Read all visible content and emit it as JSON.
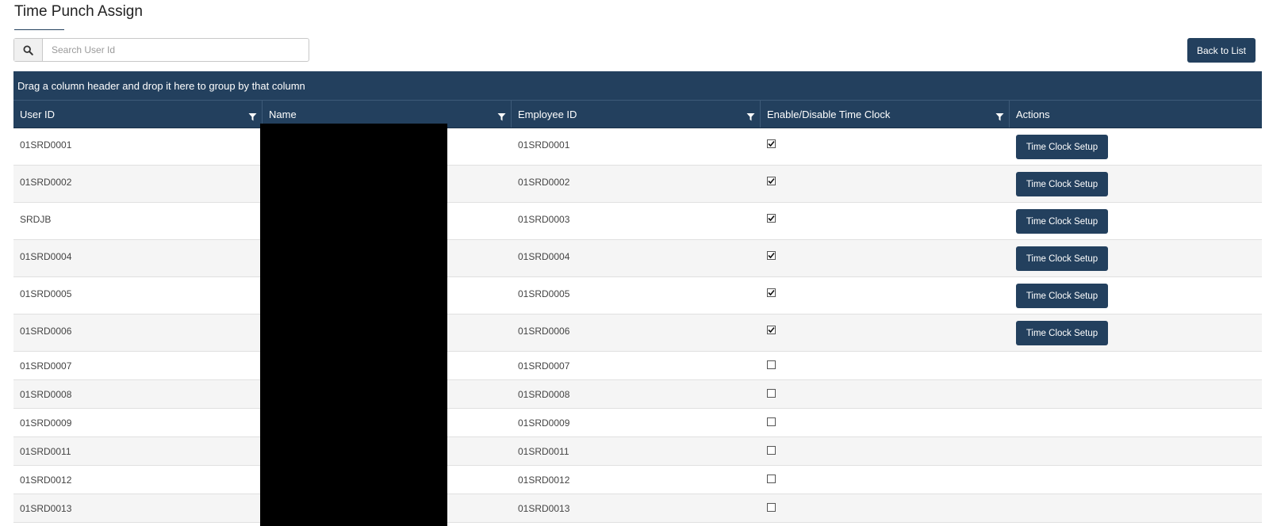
{
  "page": {
    "title": "Time Punch Assign"
  },
  "search": {
    "placeholder": "Search User Id",
    "value": ""
  },
  "toolbar": {
    "back_label": "Back to List"
  },
  "grid": {
    "group_hint": "Drag a column header and drop it here to group by that column",
    "columns": [
      "User ID",
      "Name",
      "Employee ID",
      "Enable/Disable Time Clock",
      "Actions"
    ],
    "action_label": "Time Clock Setup",
    "rows": [
      {
        "user_id": "01SRD0001",
        "employee_id": "01SRD0001",
        "enabled": true
      },
      {
        "user_id": "01SRD0002",
        "employee_id": "01SRD0002",
        "enabled": true
      },
      {
        "user_id": "SRDJB",
        "employee_id": "01SRD0003",
        "enabled": true
      },
      {
        "user_id": "01SRD0004",
        "employee_id": "01SRD0004",
        "enabled": true
      },
      {
        "user_id": "01SRD0005",
        "employee_id": "01SRD0005",
        "enabled": true
      },
      {
        "user_id": "01SRD0006",
        "employee_id": "01SRD0006",
        "enabled": true
      },
      {
        "user_id": "01SRD0007",
        "employee_id": "01SRD0007",
        "enabled": false
      },
      {
        "user_id": "01SRD0008",
        "employee_id": "01SRD0008",
        "enabled": false
      },
      {
        "user_id": "01SRD0009",
        "employee_id": "01SRD0009",
        "enabled": false
      },
      {
        "user_id": "01SRD0011",
        "employee_id": "01SRD0011",
        "enabled": false
      },
      {
        "user_id": "01SRD0012",
        "employee_id": "01SRD0012",
        "enabled": false
      },
      {
        "user_id": "01SRD0013",
        "employee_id": "01SRD0013",
        "enabled": false
      }
    ]
  },
  "colors": {
    "header_bg": "#23405e",
    "button_bg": "#23405e",
    "alt_row_bg": "#f5f5f5"
  }
}
